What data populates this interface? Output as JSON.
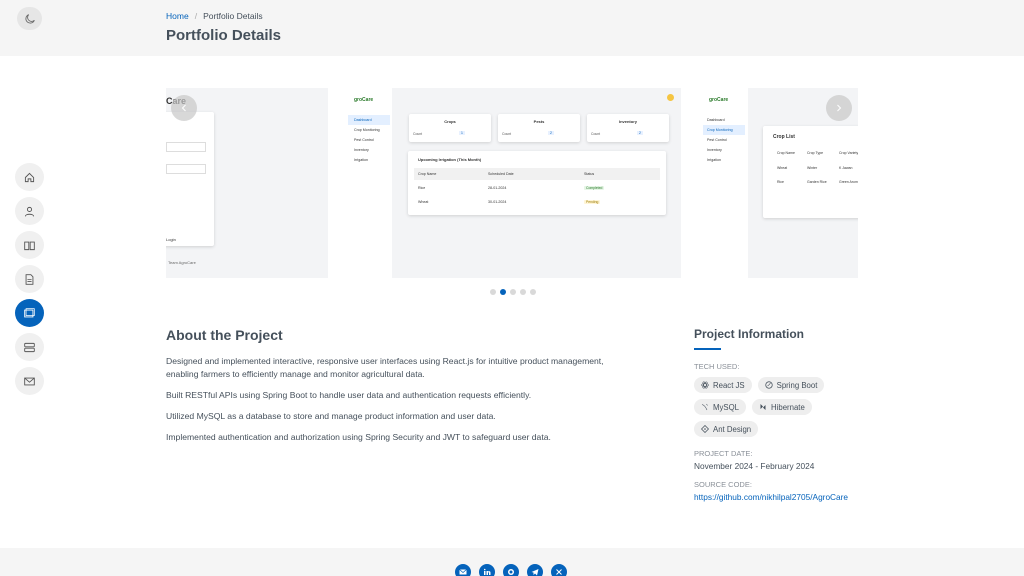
{
  "breadcrumb": {
    "home": "Home",
    "separator": "/",
    "current": "Portfolio Details"
  },
  "page_title": "Portfolio Details",
  "theme_toggle": {
    "icon": "moon-icon"
  },
  "side_nav": [
    {
      "name": "home",
      "icon": "home-icon",
      "active": false
    },
    {
      "name": "about",
      "icon": "person-icon",
      "active": false
    },
    {
      "name": "resume",
      "icon": "book-icon",
      "active": false
    },
    {
      "name": "documents",
      "icon": "file-icon",
      "active": false
    },
    {
      "name": "portfolio",
      "icon": "images-icon",
      "active": true
    },
    {
      "name": "services",
      "icon": "server-icon",
      "active": false
    },
    {
      "name": "contact",
      "icon": "envelope-icon",
      "active": false
    }
  ],
  "carousel": {
    "slide1": {
      "title": "Care",
      "link_text": "Login",
      "footer_text": "Team AgroCare"
    },
    "slide2": {
      "brand": "groCare",
      "menu": [
        "Dashboard",
        "Crop Monitoring",
        "Pest Control",
        "Inventory",
        "Irrigation"
      ],
      "cards": [
        {
          "title": "Crops",
          "label": "Count",
          "value": "1"
        },
        {
          "title": "Pests",
          "label": "Count",
          "value": "2"
        },
        {
          "title": "Inventory",
          "label": "Count",
          "value": "2"
        }
      ],
      "table_title": "Upcoming Irrigation (This Month)",
      "columns": [
        "Crop Name",
        "Scheduled Date",
        "Status"
      ],
      "rows": [
        [
          "Rice",
          "28-01-2024",
          "Completed"
        ],
        [
          "Wheat",
          "30-01-2024",
          "Pending"
        ]
      ]
    },
    "slide3": {
      "brand": "groCare",
      "menu": [
        "Dashboard",
        "Crop Monitoring",
        "Pest Control",
        "Inventory",
        "Irrigation"
      ],
      "list_title": "Crop List",
      "columns": [
        "Crop Name",
        "Crop Type",
        "Crop Variety"
      ],
      "rows": [
        [
          "Wheat",
          "Winter",
          "K Jawan"
        ],
        [
          "Rice",
          "Garden Rice",
          "Green Aroma"
        ]
      ]
    },
    "dot_count": 5,
    "active_dot": 1
  },
  "about": {
    "title": "About the Project",
    "paragraphs": [
      "Designed and implemented interactive, responsive user interfaces using React.js for intuitive product management, enabling farmers to efficiently manage and monitor agricultural data.",
      "Built RESTful APIs using Spring Boot to handle user data and authentication requests efficiently.",
      "Utilized MySQL as a database to store and manage product information and user data.",
      "Implemented authentication and authorization using Spring Security and JWT to safeguard user data."
    ]
  },
  "project_info": {
    "title": "Project Information",
    "tech_label": "TECH USED:",
    "tech": [
      {
        "label": "React JS",
        "icon": "react-icon"
      },
      {
        "label": "Spring Boot",
        "icon": "spring-icon"
      },
      {
        "label": "MySQL",
        "icon": "mysql-icon"
      },
      {
        "label": "Hibernate",
        "icon": "hibernate-icon"
      },
      {
        "label": "Ant Design",
        "icon": "antdesign-icon"
      }
    ],
    "date_label": "PROJECT DATE:",
    "date_value": "November 2024 - February 2024",
    "source_label": "SOURCE CODE:",
    "source_value": "https://github.com/nikhilpal2705/AgroCare"
  },
  "footer": {
    "socials": [
      "envelope-icon",
      "linkedin-icon",
      "github-icon",
      "telegram-icon",
      "x-icon"
    ]
  },
  "colors": {
    "accent": "#0563bb",
    "text": "#45505b",
    "header_bg": "#f5f5f5"
  }
}
